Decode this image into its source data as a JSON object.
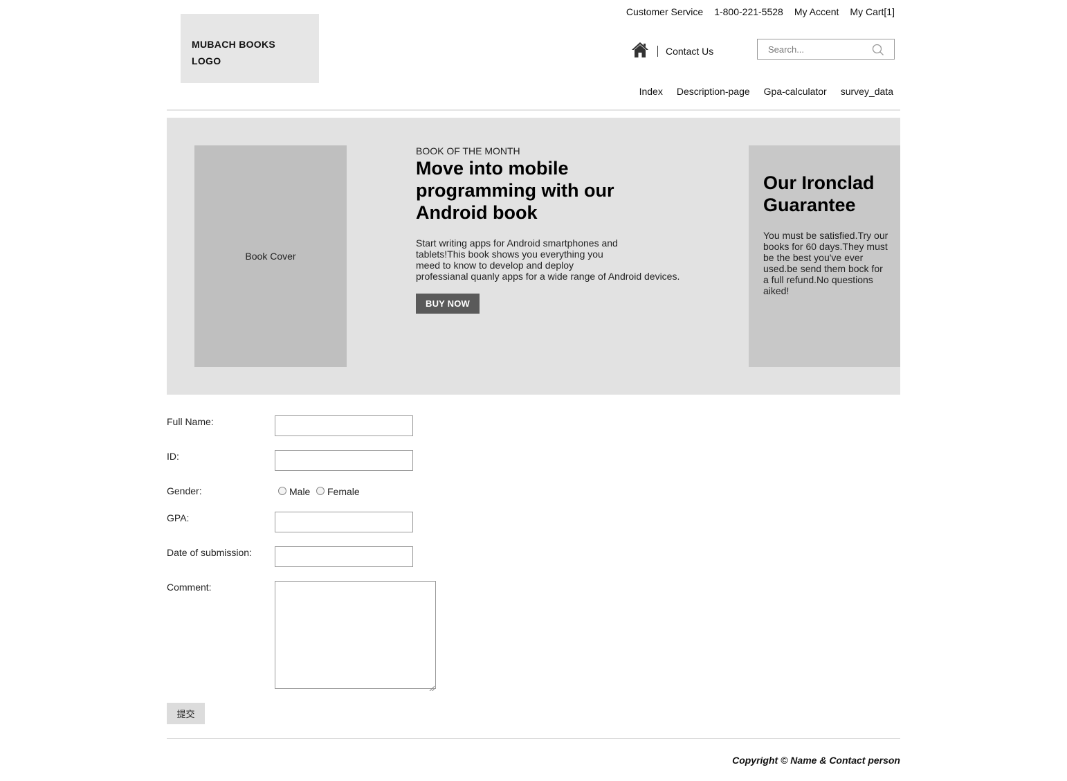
{
  "logo": {
    "line1": "MUBACH BOOKS",
    "line2": "LOGO"
  },
  "top_links": [
    "Customer Service",
    "1-800-221-5528",
    "My Accent",
    "My Cart[1]"
  ],
  "header": {
    "home_icon": "home-icon",
    "contact_label": "Contact Us",
    "search_placeholder": "Search...",
    "search_icon": "search-icon"
  },
  "nav": [
    "Index",
    "Description-page",
    "Gpa-calculator",
    "survey_data"
  ],
  "hero": {
    "cover_label": "Book Cover",
    "kicker": "BOOK OF THE MONTH",
    "headline": "Move into mobile programming with our Android book",
    "blurb_lines": [
      "Start writing apps for Android smartphones and",
      "tablets!This book shows you everything you",
      "meed to know to develop and deploy",
      "professianal quanly apps for a wide range of Android devices."
    ],
    "buy_label": "BUY NOW",
    "guarantee_title": "Our Ironclad Guarantee",
    "guarantee_text": "You must be satisfied.Try our books for 60 days.They must be the best you've ever used.be send them bock for a full refund.No questions aiked!"
  },
  "form": {
    "full_name_label": "Full Name:",
    "full_name_value": "",
    "id_label": "ID:",
    "id_value": "",
    "gender_label": "Gender:",
    "gender_options": [
      "Male",
      "Female"
    ],
    "gpa_label": "GPA:",
    "gpa_value": "",
    "date_label": "Date of submission:",
    "date_value": "",
    "comment_label": "Comment:",
    "comment_value": "",
    "submit_label": "提交"
  },
  "footer": {
    "copyright": "Copyright © Name & Contact person"
  },
  "colors": {
    "hero_bg": "#e2e2e2",
    "cover_bg": "#bfbfbf",
    "guarantee_bg": "#c8c8c8",
    "buy_button_bg": "#5a5a5a",
    "logo_bg": "#e6e6e6"
  }
}
